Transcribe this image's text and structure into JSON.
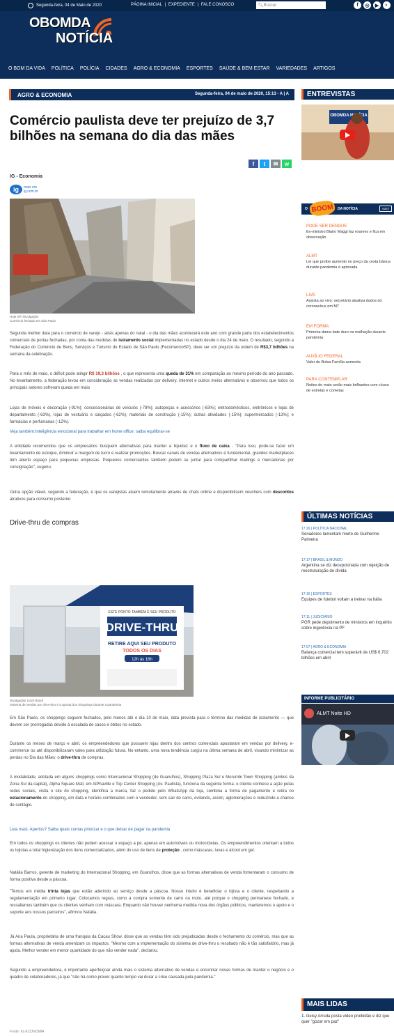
{
  "topbar": {
    "date": "Segunda-feira, 04 de Maio de 2020",
    "links": [
      "PÁGINA INICIAL",
      "EXPEDIENTE",
      "FALE CONOSCO"
    ],
    "separator": "|",
    "search_placeholder": "Buscar",
    "socials": [
      "f",
      "◎",
      "▶",
      "◐"
    ]
  },
  "logo": {
    "line1": "OBOMDA",
    "line2": "NOTÍCIA"
  },
  "nav": [
    "O BOM DA VIDA",
    "POLÍTICA",
    "POLÍCIA",
    "CIDADES",
    "AGRO & ECONOMIA",
    "ESPORTES",
    "SAÚDE & BEM ESTAR",
    "VARIEDADES",
    "ARTIGOS"
  ],
  "article": {
    "section": "AGRO & ECONOMIA",
    "timestamp": "Segunda-feira, 04 de maio de 2020, 15:13",
    "font_controls": "A | A",
    "headline": "Comércio paulista deve ter prejuízo de 3,7 bilhões na semana do dia das mães",
    "share": [
      "f",
      "t",
      "✉",
      "w"
    ],
    "byline": "IG - Economia",
    "source_logo": {
      "mark": "ig",
      "line1": "mais em",
      "line2": "ig.com.br"
    },
    "photo1_caption": [
      "Hoje SP/ Divulgação",
      "Comércio fechado em São Paulo"
    ],
    "paragraphs": [
      {
        "pre": "Segunda melhor data para o comércio de varejo - atrás apenas do natal - o dia das mães acontecerá este ano com grande parte dos estabelecimentos comerciais de portas fechadas, por conta das medidas de ",
        "b1": "isolamento social",
        "mid": " implementadas no estado desde o dia 24 de maio. O resultado, segundo a Federação do Comércio de Bens, Serviços e Turismo do Estado de São Paulo (FecomercioSP), deve ser um prejuízo da ordem de ",
        "b2": "R$3,7 bilhões",
        "post": " na semana da celebração."
      },
      {
        "pre": "Para o mês de maio, o déficit pode atingir ",
        "b1": "R$ 19,3 bilhões",
        "mid": " , o que representa uma ",
        "b2": "queda de 31%",
        "post": " em comparação ao mesmo período do ano passado. No levantamento, a federação levou em consideração as vendas realizadas por delivery, internet e outros meios alternativos e observou que todos os principais setores sofreram queda em maio"
      },
      {
        "text": "Lojas de móveis e decoração (-91%); concessionárias de veículos (-78%); autopeças e acessórios (-63%); eletrodomésticos, eletrônicos e lojas de departamento (-63%), lojas de vestuário e calçados (-62%); materiais de construção (-15%); outras atividades (-15%); supermercados (-13%); e farmácias e perfumarias (-12%)."
      },
      {
        "pre": "A entidade recomendou que os empresários busquem alternativas para manter a liquidez e o ",
        "b1": "fluxo de caixa",
        "post": " . \"Para isso, pode-se fazer um levantamento de estoque, diminuir a margem de lucro e realizar promoções. Buscar canais de vendas alternativos é fundamental, grandes marketplaces têm aberto espaço para pequenas empresas. Pequenos comerciantes também podem se juntar para compartilhar mailings e mercadorias por consignação\", sugeriu."
      },
      {
        "pre": "Outra opção viável, segundo a federação, é que os varejistas atuem remotamente através de chats online e disponibilizem vouchers com ",
        "b1": "descontos",
        "post": " atrativos para consumo posterior."
      },
      {
        "pre": "Em São Paulo, os shoppings seguem fechados, pelo menos até o dia 10 de maio, data prevista para o término das medidas de isolamento — que devem ser prorrogadas devido à escalada de casos e óbitos no estado."
      },
      {
        "pre": "Durante os meses de março e abril, os empreendedores que possuem lojas dentro dos centros comerciais apostaram em vendas por delivery, e-commerce ou até disponibilizaram vales para utilização futura. No entanto, uma nova tendência surgiu na última semana de abril, visando minimizar as perdas no Dia das Mães: o ",
        "b1": "drive-thru",
        "post": " de compras."
      },
      {
        "pre": "A modalidade, adotada em alguns shoppings como Internacional Shopping (de Guarulhos), Shopping Plaza Sul e Morumbi Town Shopping (ambos da Zona Sul da capital), Alpha Square Mall, em AlPhaville e Top Center Shopping (Av. Paulista), funciona da seguinte forma: o cliente conhece a ação pelas redes sociais, visita o site do shopping, identifica a marca, faz o pedido pelo WhatsApp da loja, combina a forma de pagamento e retira no ",
        "b1": "estacionamento",
        "post": " do shopping, em data e horário combinados com o vendedor, sem sair do carro, evitando, assim, aglomerações e reduzindo a chance de contágio."
      },
      {
        "pre": "Em todos os shoppings os clientes não podem acessar o espaço a pé, apenas em automóveis ou motocicletas. Os empreendimentos orientam a todos os lojistas a total higienização dos itens comercializados, além do uso de itens de ",
        "b1": "proteção",
        "post": " , como máscaras, luvas e álcool em gel."
      },
      {
        "pre": "Natália Barros, gerente de marketing do Internacional Shopping, em Guarulhos, disse que as formas alternativas de venda fomentaram o consumo de forma positiva desde a páscoa."
      },
      {
        "pre": "\"Temos em média ",
        "b1": "trinta lojas",
        "post": " que estão aderindo ao serviço desde a páscoa. Nosso intuito é beneficiar o lojista e o cliente, respeitando a regulamentação em primeiro lugar. Colocamos regras, como a compra somente de carro ou moto, até porque o shopping permanece fechado, e ressaltamos também que os clientes venham com máscara. Enquanto não houver nenhuma medida nova dos órgãos públicos, manteremos o apoio e o suporte aos nossos parceiros\", afirmou Natália."
      },
      {
        "pre": "Já Ana Paula, proprietária de uma franquia da Cacau Show, disse que as vendas têm sido prejudicadas desde o fechamento do comércio, mas que as formas alternativas de venda amenizam os impactos. \"Mesmo com a implementação do sistema de drive-thru o resultado não é tão satisfatório, mas já ajuda. Melhor vender em menor quantidade do que não vender nada\", declarou."
      },
      {
        "pre": "Segundo a empreendedora, é importante aperfeiçoar ainda mais o sistema alternativo de vendas e encontrar novas formas de manter o negócio e o quadro de colaboradores, já que \"não há como prever quanto tempo vai durar a crise causada pela pandemia.\""
      }
    ],
    "link1": "Veja também:Inteligência emocional para trabalhar em home office: saiba equilibrar-se",
    "subhead": "Drive-thru de compras",
    "photo2_caption": [
      "Divulgação/ Gazit Brasil",
      "Sistema de vendas por drive-thru é a aposta dos shoppings durante a pandemia"
    ],
    "photo2_sign": {
      "small": "ESTE PONTO TAMBÉM É SEU PRODUTO",
      "big": "DRIVE-THRU",
      "line1": "RETIRE AQUI SEU PRODUTO",
      "line2": "TODOS OS DIAS",
      "line3": "12h às 18h"
    },
    "link2": "Leia mais: Apertou? Saiba quais contas priorizar e o que deixar de pagar na pandemia",
    "source": "Fonte: IG ECONOMIA"
  },
  "sidebar": {
    "entrevistas": "ENTREVISTAS",
    "boom": {
      "o": "O",
      "boom": "BOOM",
      "suffix": "DA NOTÍCIA",
      "mais": "MAIS"
    },
    "boom_items": [
      {
        "tag": "PODE SER DENGUE",
        "text": "Ex-ministro Blairo Maggi faz exames e fica em observação"
      },
      {
        "tag": "ALMT",
        "text": "Lei que proíbe aumento no preço da cesta básica durante pandemia é aprovada"
      },
      {
        "tag": "LIVE",
        "text": "Assista ao vivo: secretário atualiza dados do coronavírus em MT"
      },
      {
        "tag": "EM FORMA",
        "text": "Primeira-dama bate duro na malhação durante pandemia"
      },
      {
        "tag": "AUXÍLIO FEDERAL",
        "text": "Valor do Bolsa Família aumenta"
      },
      {
        "tag": "PARA CONTEMPLAR",
        "text": "Noites de maio serão mais brilhantes com chuva de estrelas e cometas"
      }
    ],
    "ultimas": "ÚLTIMAS NOTÍCIAS",
    "news": [
      {
        "meta": "17:26 | POLÍTICA NACIONAL",
        "text": "Senadores lamentam morte de Guilherme Palmeira"
      },
      {
        "meta": "17:17 | BRASIL & MUNDO",
        "text": "Argentina se diz decepcionada com rejeição de reestruturação de dívida"
      },
      {
        "meta": "17:16 | ESPORTES",
        "text": "Equipes de futebol voltam a treinar na Itália"
      },
      {
        "meta": "17:11 | JUDICIÁRIO",
        "text": "PGR pede depoimento de ministros em inquérito sobre ingerência na PF"
      },
      {
        "meta": "17:07 | AGRO & ECONOMIA",
        "text": "Balança comercial tem superávit de US$ 6,702 bilhões em abril"
      }
    ],
    "informe": "INFORME PUBLICITÁRIO",
    "video2_title": "ALMT Noite HD",
    "video1_logo": "OBOMDA NOTÍCIA",
    "mais_lidas": "MAIS LIDAS",
    "lidas": [
      {
        "n": "1.",
        "text": "Geisy Arruda posta vídeo proibidão e diz que quer \"gozar em paz\""
      }
    ]
  },
  "colors": {
    "navy": "#0d2e5a",
    "orange": "#f26522",
    "link": "#2b6cb0"
  }
}
